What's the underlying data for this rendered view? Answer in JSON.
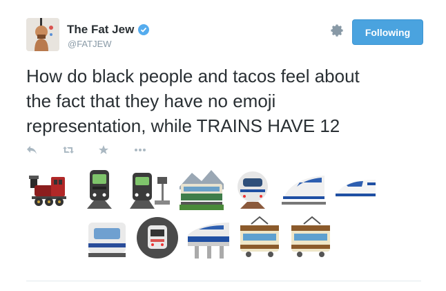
{
  "user": {
    "name": "The Fat Jew",
    "handle": "@FATJEW"
  },
  "follow_button": {
    "label": "Following"
  },
  "tweet": {
    "text": "How do black people and tacos feel about\nthe fact that they have no emoji\nrepresentation, while TRAINS HAVE 12"
  },
  "actions": [
    "reply-icon",
    "retweet-icon",
    "favorite-icon",
    "more-icon"
  ],
  "emoji_icons": [
    "steam-locomotive-icon",
    "train-icon",
    "station-train-icon",
    "railway-car-icon",
    "high-speed-train-front-icon",
    "high-speed-train-icon",
    "bullet-train-icon",
    "light-rail-icon",
    "metro-icon",
    "monorail-icon",
    "tram-icon",
    "tram-car-icon"
  ],
  "colors": {
    "accent": "#55acee",
    "button": "#4aa3df",
    "text": "#292f33",
    "muted": "#8899a6"
  }
}
